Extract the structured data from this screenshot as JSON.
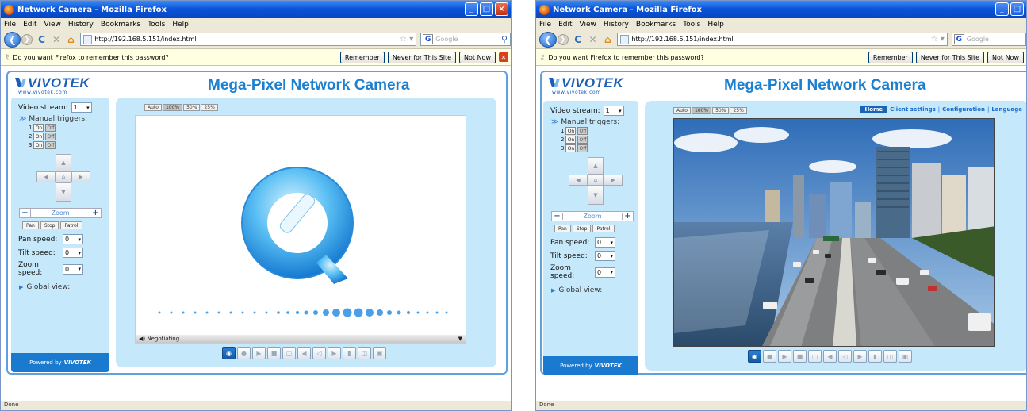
{
  "browser": {
    "window_title": "Network Camera - Mozilla Firefox",
    "menu": [
      "File",
      "Edit",
      "View",
      "History",
      "Bookmarks",
      "Tools",
      "Help"
    ],
    "url": "http://192.168.5.151/index.html",
    "search_placeholder": "Google",
    "password_prompt": "Do you want Firefox to remember this password?",
    "remember_label": "Remember",
    "never_label": "Never for This Site",
    "notnow_label": "Not Now",
    "status_text": "Done"
  },
  "page": {
    "title": "Mega-Pixel Network Camera",
    "logo": "VIVOTEK",
    "logo_sub": "www.vivotek.com",
    "powered_by": "Powered by",
    "powered_brand": "VIVOTEK"
  },
  "controls": {
    "video_stream_label": "Video stream:",
    "video_stream_value": "1",
    "manual_triggers_label": "Manual triggers:",
    "triggers": [
      "1",
      "2",
      "3"
    ],
    "on_label": "On",
    "off_label": "Off",
    "zoom_label": "Zoom",
    "zoom_minus": "−",
    "zoom_plus": "+",
    "pan_label": "Pan",
    "stop_label": "Stop",
    "patrol_label": "Patrol",
    "pan_speed_label": "Pan speed:",
    "pan_speed_value": "0",
    "tilt_speed_label": "Tilt speed:",
    "tilt_speed_value": "0",
    "zoom_speed_label": "Zoom speed:",
    "zoom_speed_value": "0",
    "global_view_label": "Global view:"
  },
  "viewer": {
    "size_buttons": [
      "Auto",
      "100%",
      "50%",
      "25%"
    ],
    "selected_size": "100%",
    "qt_status": "Negotiating"
  },
  "nav_links": {
    "home": "Home",
    "client_settings": "Client settings",
    "configuration": "Configuration",
    "language": "Language"
  },
  "colors": {
    "accent": "#1c80d0",
    "sidebar_bg": "#c6e8fb",
    "powered_bg": "#1a7ad0"
  }
}
